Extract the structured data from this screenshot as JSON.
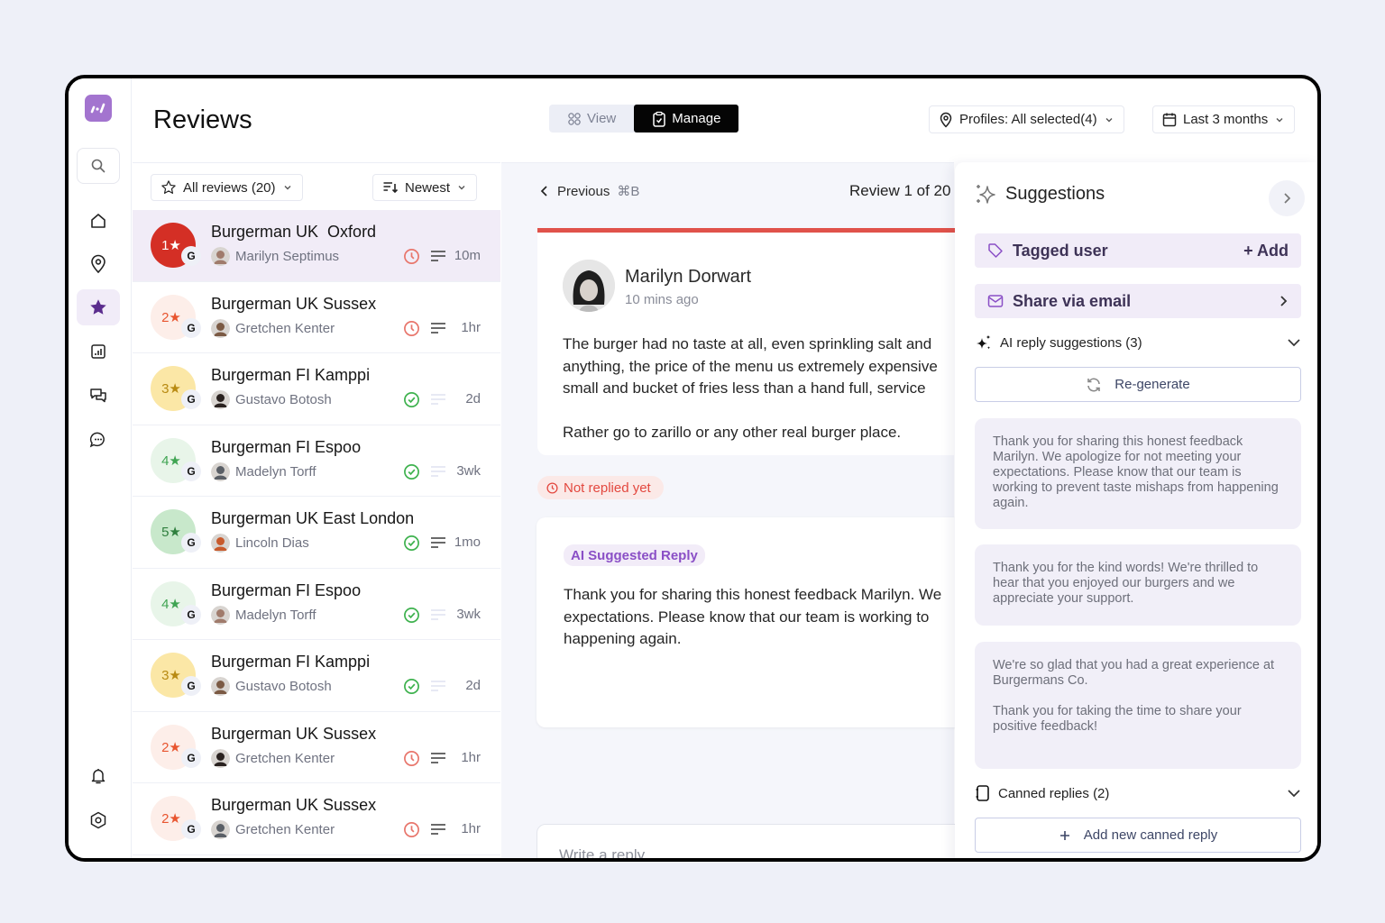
{
  "app": {
    "page_title": "Reviews",
    "brand_color": "#a374cf"
  },
  "rail": {
    "items": [
      {
        "name": "home",
        "icon": "home-icon"
      },
      {
        "name": "locations",
        "icon": "map-pin-icon"
      },
      {
        "name": "reviews",
        "icon": "star-icon",
        "active": true
      },
      {
        "name": "reports",
        "icon": "bar-chart-icon"
      },
      {
        "name": "conversations",
        "icon": "chat-bubbles-icon"
      },
      {
        "name": "messages",
        "icon": "message-dots-icon"
      },
      {
        "name": "notifications",
        "icon": "bell-icon"
      },
      {
        "name": "settings",
        "icon": "settings-icon"
      }
    ]
  },
  "header": {
    "view_label": "View",
    "manage_label": "Manage",
    "profiles_label": "Profiles: All selected(4)",
    "date_range_label": "Last 3 months"
  },
  "list": {
    "filter_label": "All reviews (20)",
    "sort_label": "Newest",
    "reviews": [
      {
        "rating": "1★",
        "location": "Burgerman UK  Oxford",
        "user": "Marilyn Septimus",
        "status": "pending",
        "time": "10m",
        "has_text": true,
        "selected": true
      },
      {
        "rating": "2★",
        "location": "Burgerman UK Sussex",
        "user": "Gretchen Kenter",
        "status": "pending",
        "time": "1hr",
        "has_text": true
      },
      {
        "rating": "3★",
        "location": "Burgerman FI Kamppi",
        "user": "Gustavo Botosh",
        "status": "replied",
        "time": "2d",
        "has_text": false
      },
      {
        "rating": "4★",
        "location": "Burgerman FI Espoo",
        "user": "Madelyn Torff",
        "status": "replied",
        "time": "3wk",
        "has_text": false
      },
      {
        "rating": "5★",
        "location": "Burgerman UK East London",
        "user": "Lincoln Dias",
        "status": "replied",
        "time": "1mo",
        "has_text": true
      },
      {
        "rating": "4★",
        "location": "Burgerman FI Espoo",
        "user": "Madelyn Torff",
        "status": "replied",
        "time": "3wk",
        "has_text": false
      },
      {
        "rating": "3★",
        "location": "Burgerman FI Kamppi",
        "user": "Gustavo Botosh",
        "status": "replied",
        "time": "2d",
        "has_text": false
      },
      {
        "rating": "2★",
        "location": "Burgerman UK Sussex",
        "user": "Gretchen Kenter",
        "status": "pending",
        "time": "1hr",
        "has_text": true
      },
      {
        "rating": "2★",
        "location": "Burgerman UK Sussex",
        "user": "Gretchen Kenter",
        "status": "pending",
        "time": "1hr",
        "has_text": true
      }
    ],
    "source_badge": "G"
  },
  "review": {
    "previous_label": "Previous",
    "previous_shortcut": "⌘B",
    "counter": "Review 1 of 20",
    "reviewer_name": "Marilyn Dorwart",
    "reviewer_time": "10 mins ago",
    "paragraphs": [
      "The burger had no taste at all, even sprinkling salt and\nanything, the price of the menu us extremely expensive\nsmall and bucket of fries less than a hand full, service",
      "Rather go to zarillo or any other real burger place."
    ],
    "reply_status": "Not replied yet",
    "ai_tag": "AI Suggested Reply",
    "ai_reply": "Thank you for sharing this honest feedback Marilyn. We\nexpectations. Please know that our team is working to\nhappening again.",
    "reply_placeholder": "Write a reply"
  },
  "suggestions": {
    "title": "Suggestions",
    "tagged_user_label": "Tagged user",
    "add_label": "+ Add",
    "share_label": "Share via email",
    "ai_section_label": "AI reply suggestions (3)",
    "regenerate_label": "Re-generate",
    "cards": [
      {
        "paragraphs": [
          "Thank you for sharing this honest feedback Marilyn. We apologize for not meeting your expectations. Please know that our team is working to prevent taste mishaps from happening again."
        ]
      },
      {
        "paragraphs": [
          "Thank you for the kind words! We're thrilled to hear that you enjoyed our burgers and we appreciate your support."
        ]
      },
      {
        "paragraphs": [
          "We're so glad that you had a great experience at Burgermans Co.",
          "Thank you for taking the time to share your positive feedback!"
        ]
      }
    ],
    "canned_label": "Canned replies (2)",
    "add_canned_label": "Add new canned reply"
  }
}
